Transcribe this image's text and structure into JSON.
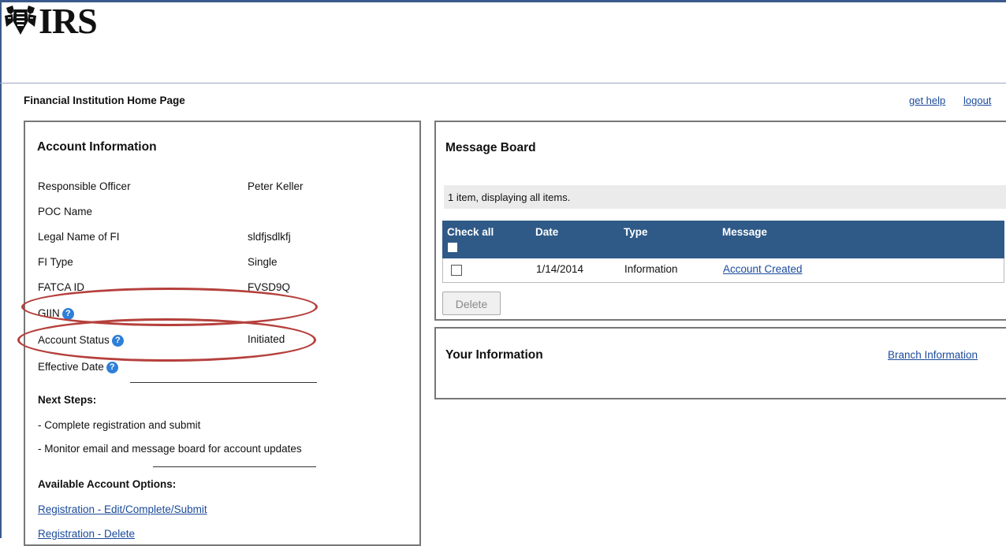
{
  "header": {
    "logo_text": "IRS",
    "page_title": "Financial Institution Home Page",
    "links": {
      "help": "get help",
      "logout": "logout"
    }
  },
  "account_info": {
    "title": "Account Information",
    "rows": [
      {
        "label": "Responsible Officer",
        "value": "Peter Keller"
      },
      {
        "label": "POC Name",
        "value": ""
      },
      {
        "label": "Legal Name of FI",
        "value": "sldfjsdlkfj"
      },
      {
        "label": "FI Type",
        "value": "Single"
      },
      {
        "label": "FATCA ID",
        "value": "FVSD9Q"
      },
      {
        "label": "GIIN",
        "value": ""
      },
      {
        "label": "Account Status",
        "value": "Initiated"
      },
      {
        "label": "Effective Date",
        "value": ""
      }
    ],
    "next_steps_title": "Next Steps:",
    "next_steps": [
      "- Complete registration and submit",
      "- Monitor email and message board for account updates"
    ],
    "options_title": "Available Account Options:",
    "options": [
      "Registration - Edit/Complete/Submit",
      "Registration - Delete"
    ]
  },
  "message_board": {
    "title": "Message Board",
    "item_count": "1 item, displaying all items.",
    "columns": [
      "Check all",
      "Date",
      "Type",
      "Message"
    ],
    "rows": [
      {
        "date": "1/14/2014",
        "type": "Information",
        "message": "Account Created"
      }
    ],
    "delete_label": "Delete"
  },
  "your_information": {
    "title": "Your Information",
    "branch_link": "Branch Information"
  },
  "colors": {
    "table_header": "#2f5a87",
    "link": "#1b4a9b",
    "annotation": "#b5403c",
    "help_icon": "#2e7fd8"
  }
}
